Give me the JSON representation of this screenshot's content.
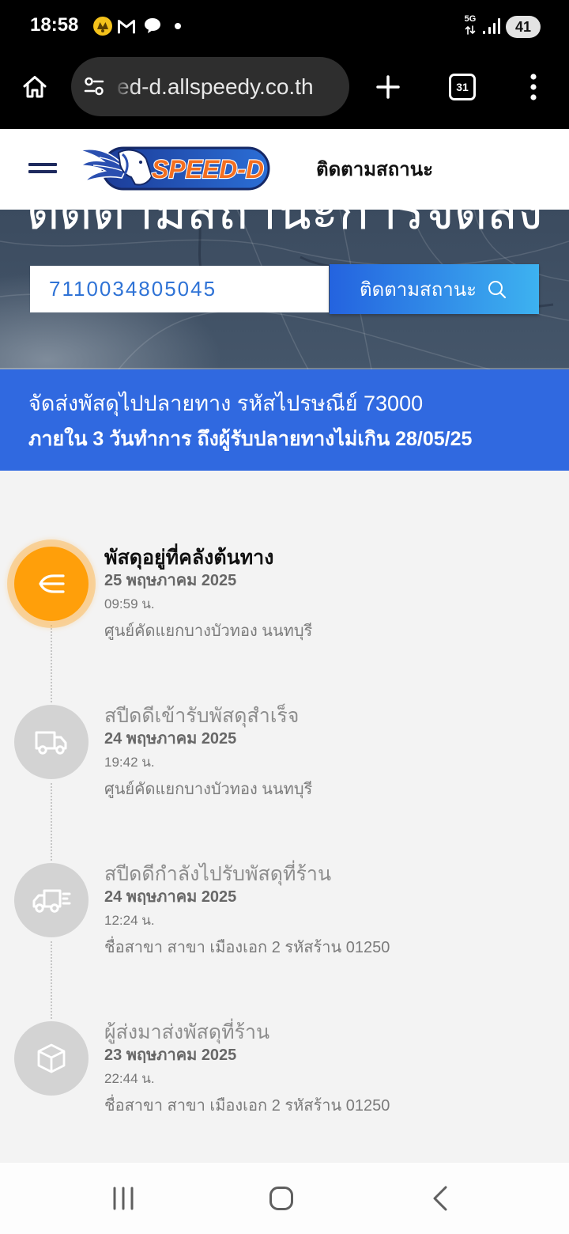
{
  "status_bar": {
    "time": "18:58",
    "network_type": "5G",
    "battery_level": "41",
    "notification_icons": [
      "bank-app-icon",
      "gmail-icon",
      "chat-icon",
      "more-notifications-dot-icon"
    ],
    "system_icons": [
      "data-transfer-icon",
      "signal-icon"
    ]
  },
  "browser": {
    "url": "ed-d.allspeedy.co.th",
    "tab_count": "31",
    "icons": [
      "home-icon",
      "site-settings-icon",
      "new-tab-icon",
      "tab-switcher-icon",
      "more-menu-icon"
    ]
  },
  "site_header": {
    "menu_icon": "hamburger-menu-icon",
    "logo_text": "SPEED-D",
    "nav_title": "ติดตามสถานะ"
  },
  "hero": {
    "heading": "ติดตามสถานะการจัดส่ง",
    "tracking_number": "7110034805045",
    "track_button_label": "ติดตามสถานะ",
    "track_button_icon": "search-icon"
  },
  "delivery_banner": {
    "line1": "จัดส่งพัสดุไปปลายทาง รหัสไปรษณีย์ 73000",
    "line2": "ภายใน 3 วันทำการ ถึงผู้รับปลายทางไม่เกิน 28/05/25"
  },
  "timeline": [
    {
      "title": "พัสดุอยู่ที่คลังต้นทาง",
      "date": "25 พฤษภาคม 2025",
      "time": "09:59 น.",
      "location": "ศูนย์คัดแยกบางบัวทอง นนทบุรี",
      "icon": "origin-hub-arrow-icon",
      "current": true
    },
    {
      "title": "สปีดดีเข้ารับพัสดุสำเร็จ",
      "date": "24 พฤษภาคม 2025",
      "time": "19:42 น.",
      "location": "ศูนย์คัดแยกบางบัวทอง นนทบุรี",
      "icon": "truck-icon",
      "current": false
    },
    {
      "title": "สปีดดีกำลังไปรับพัสดุที่ร้าน",
      "date": "24 พฤษภาคม 2025",
      "time": "12:24 น.",
      "location": "ชื่อสาขา สาขา เมืองเอก 2 รหัสร้าน 01250",
      "icon": "moving-truck-icon",
      "current": false
    },
    {
      "title": "ผู้ส่งมาส่งพัสดุที่ร้าน",
      "date": "23 พฤษภาคม 2025",
      "time": "22:44 น.",
      "location": "ชื่อสาขา สาขา เมืองเอก 2 รหัสร้าน 01250",
      "icon": "package-icon",
      "current": false
    }
  ],
  "nav_bar": {
    "icons": [
      "recent-apps-icon",
      "home-button-icon",
      "back-icon"
    ]
  },
  "colors": {
    "accent_orange": "#ff9f0a",
    "brand_blue": "#3069e0",
    "inactive_gray": "#d3d3d3",
    "tracking_text_blue": "#2f73d6"
  }
}
